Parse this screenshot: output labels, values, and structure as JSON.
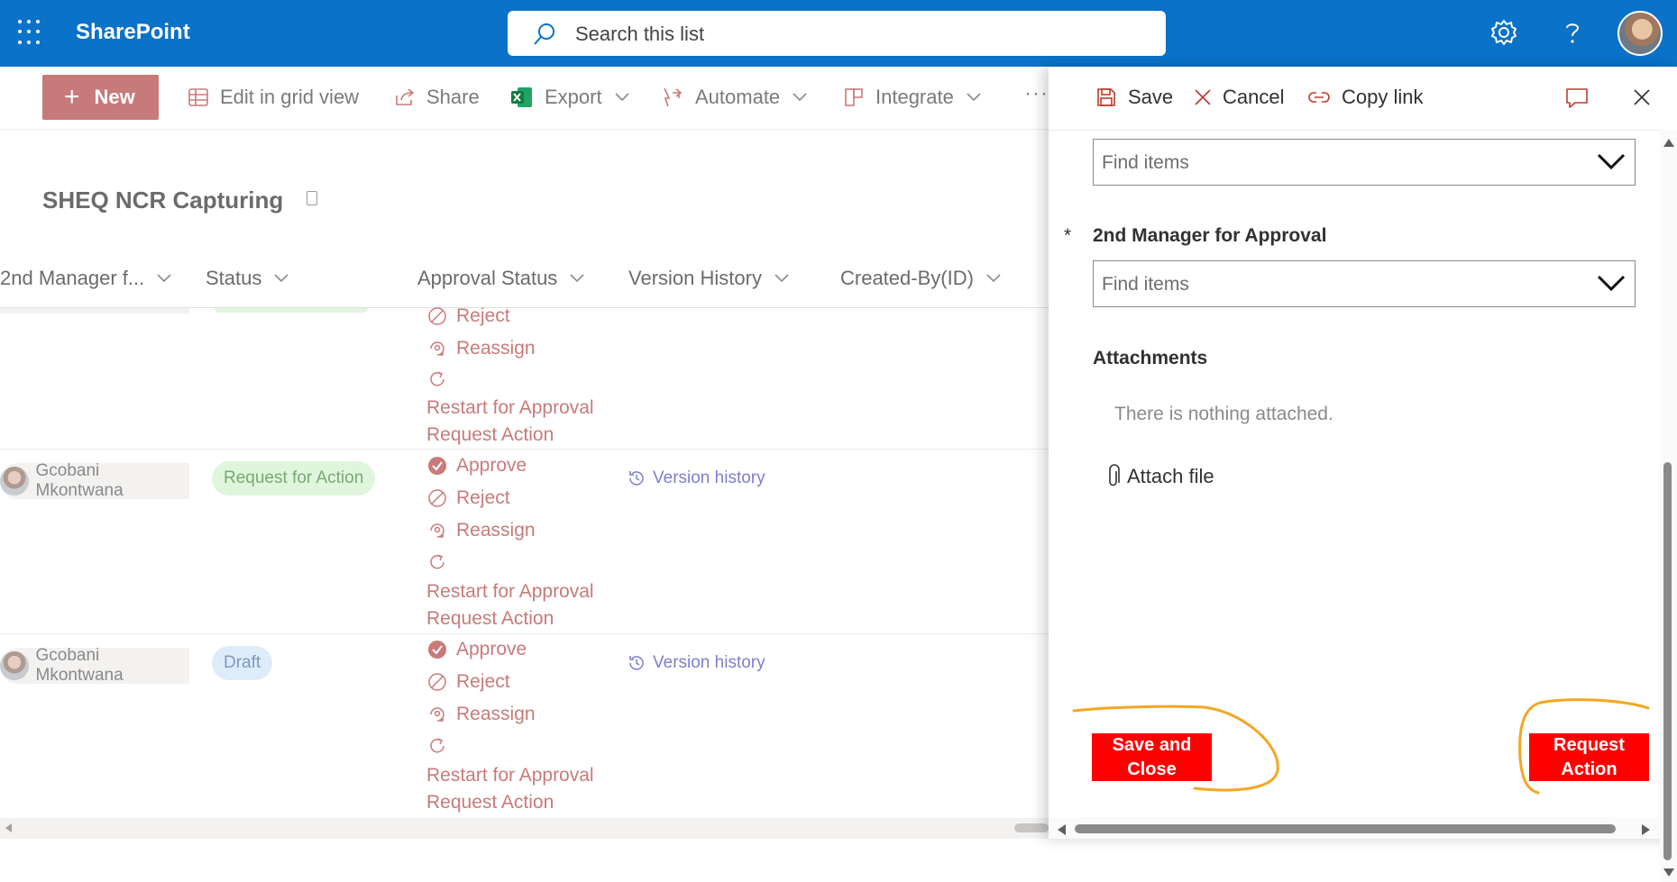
{
  "suitebar": {
    "app_name": "SharePoint",
    "search_placeholder": "Search this list",
    "icons": [
      "app-launcher-icon",
      "search-icon",
      "settings-icon",
      "help-icon",
      "avatar"
    ]
  },
  "commandbar": {
    "new_label": "New",
    "edit_grid_label": "Edit in grid view",
    "share_label": "Share",
    "export_label": "Export",
    "automate_label": "Automate",
    "integrate_label": "Integrate",
    "more_label": "···"
  },
  "list": {
    "title": "SHEQ NCR Capturing",
    "columns": {
      "manager": "2nd Manager f...",
      "status": "Status",
      "approval": "Approval Status",
      "version": "Version History",
      "created": "Created-By(ID)"
    },
    "rows": [
      {
        "actions": [
          "Reject",
          "Reassign",
          "",
          "Restart for Approval",
          "Request Action"
        ]
      },
      {
        "person": "Gcobani Mkontwana",
        "status": "Request for Action",
        "actions": [
          "Approve",
          "Reject",
          "Reassign",
          "",
          "Restart for Approval",
          "Request Action"
        ],
        "version": "Version history"
      },
      {
        "person": "Gcobani Mkontwana",
        "status": "Draft",
        "actions": [
          "Approve",
          "Reject",
          "Reassign",
          "",
          "Restart for Approval",
          "Request Action"
        ],
        "version": "Version history"
      }
    ]
  },
  "panel": {
    "save_label": "Save",
    "cancel_label": "Cancel",
    "copy_link_label": "Copy link",
    "dropdown1_placeholder": "Find items",
    "required_marker": "*",
    "manager_label": "2nd Manager for Approval",
    "dropdown2_placeholder": "Find items",
    "attachments_label": "Attachments",
    "attachments_empty": "There is nothing attached.",
    "attach_file_label": "Attach file",
    "save_close_label": "Save and Close",
    "request_action_label": "Request Action"
  },
  "colors": {
    "suitebar": "#0a72c8",
    "new_button": "#c77a7a",
    "action_text": "#c97a7a",
    "red_button": "#ff0000",
    "annotation": "#f5a623"
  }
}
